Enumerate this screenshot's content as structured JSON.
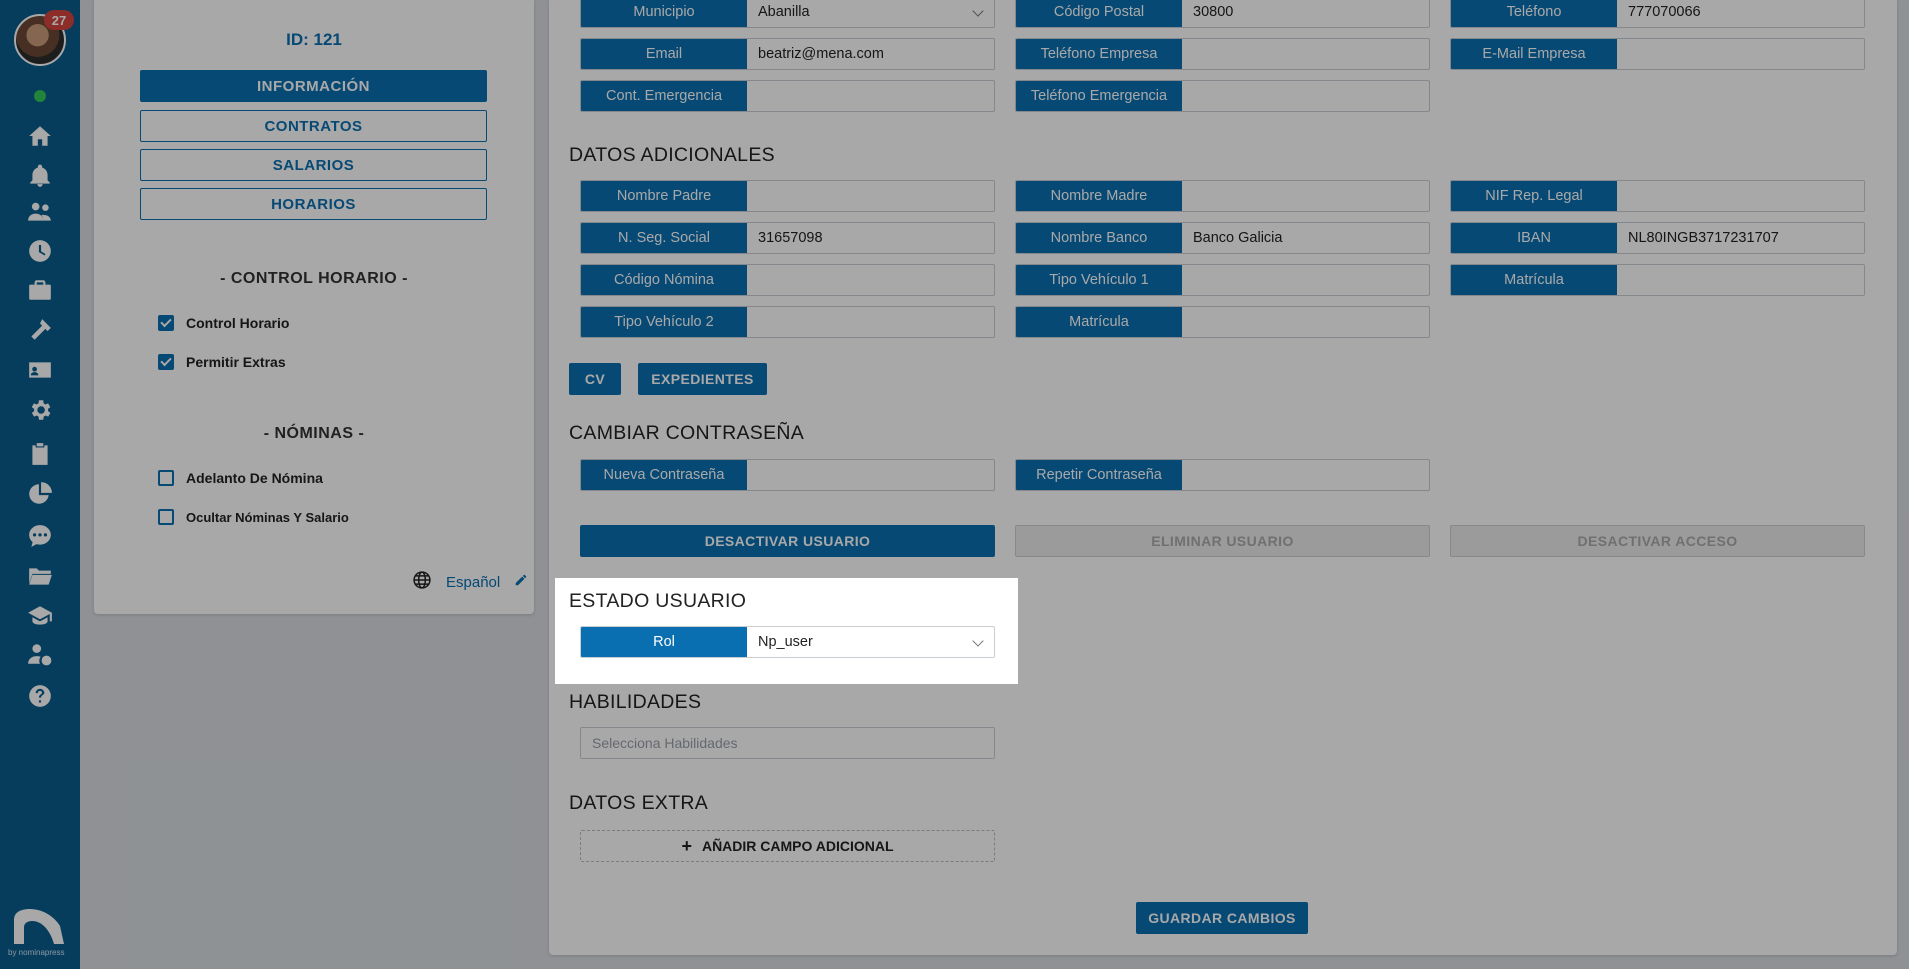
{
  "sidebar": {
    "notification_count": "27",
    "icons": [
      "home-icon",
      "bell-icon",
      "users-icon",
      "clock-icon",
      "briefcase-icon",
      "hammer-icon",
      "id-card-icon",
      "gear-icon",
      "clipboard-icon",
      "pie-chart-icon",
      "chat-icon",
      "folder-icon",
      "graduation-cap-icon",
      "user-money-icon",
      "help-icon"
    ],
    "brand": "by nominapress"
  },
  "profile": {
    "id_label": "ID: 121",
    "nav": [
      "INFORMACIÓN",
      "CONTRATOS",
      "SALARIOS",
      "HORARIOS"
    ],
    "control_horario": {
      "title": "- CONTROL HORARIO -",
      "options": [
        {
          "label": "Control Horario",
          "checked": true
        },
        {
          "label": "Permitir Extras",
          "checked": true
        }
      ]
    },
    "nominas": {
      "title": "- NÓMINAS -",
      "options": [
        {
          "label": "Adelanto De Nómina",
          "checked": false
        },
        {
          "label": "Ocultar Nóminas Y Salario",
          "checked": false
        }
      ]
    },
    "language": "Español"
  },
  "contact": {
    "municipio": {
      "label": "Municipio",
      "value": "Abanilla"
    },
    "codigo_postal": {
      "label": "Código Postal",
      "value": "30800"
    },
    "telefono": {
      "label": "Teléfono",
      "value": "777070066"
    },
    "email": {
      "label": "Email",
      "value": "beatriz@mena.com"
    },
    "telefono_empresa": {
      "label": "Teléfono Empresa",
      "value": ""
    },
    "email_empresa": {
      "label": "E-Mail Empresa",
      "value": ""
    },
    "cont_emergencia": {
      "label": "Cont. Emergencia",
      "value": ""
    },
    "telefono_emergencia": {
      "label": "Teléfono Emergencia",
      "value": ""
    }
  },
  "adicionales": {
    "title": "DATOS ADICIONALES",
    "nombre_padre": {
      "label": "Nombre Padre",
      "value": ""
    },
    "nombre_madre": {
      "label": "Nombre Madre",
      "value": ""
    },
    "nif_rep_legal": {
      "label": "NIF Rep. Legal",
      "value": ""
    },
    "seg_social": {
      "label": "N. Seg. Social",
      "value": "31657098"
    },
    "nombre_banco": {
      "label": "Nombre Banco",
      "value": "Banco Galicia"
    },
    "iban": {
      "label": "IBAN",
      "value": "NL80INGB3717231707"
    },
    "codigo_nomina": {
      "label": "Código Nómina",
      "value": ""
    },
    "tipo_vehiculo_1": {
      "label": "Tipo Vehículo 1",
      "value": ""
    },
    "matricula_1": {
      "label": "Matrícula",
      "value": ""
    },
    "tipo_vehiculo_2": {
      "label": "Tipo Vehículo 2",
      "value": ""
    },
    "matricula_2": {
      "label": "Matrícula",
      "value": ""
    },
    "cv_button": "CV",
    "expedientes_button": "EXPEDIENTES"
  },
  "password": {
    "title": "CAMBIAR CONTRASEÑA",
    "nueva": {
      "label": "Nueva Contraseña",
      "value": ""
    },
    "repetir": {
      "label": "Repetir Contraseña",
      "value": ""
    }
  },
  "actions": {
    "desactivar_usuario": "DESACTIVAR USUARIO",
    "eliminar_usuario": "ELIMINAR USUARIO",
    "desactivar_acceso": "DESACTIVAR ACCESO"
  },
  "estado": {
    "title": "ESTADO USUARIO",
    "rol": {
      "label": "Rol",
      "value": "Np_user"
    }
  },
  "habilidades": {
    "title": "HABILIDADES",
    "placeholder": "Selecciona Habilidades"
  },
  "extra": {
    "title": "DATOS EXTRA",
    "add_label": "AÑADIR CAMPO ADICIONAL"
  },
  "save_label": "GUARDAR CAMBIOS",
  "colors": {
    "primary": "#0a6fb0",
    "sidebar": "#0a5d8e",
    "badge": "#d64541"
  }
}
